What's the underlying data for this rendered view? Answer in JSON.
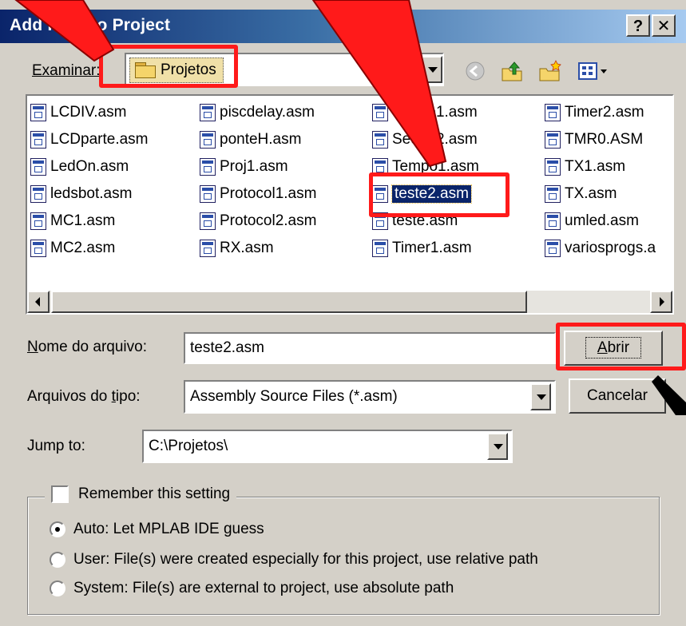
{
  "window": {
    "title": "Add Files to Project",
    "help_button": "?",
    "close_button": "✕"
  },
  "lookin": {
    "label": "Examinar:",
    "value": "Projetos"
  },
  "files": [
    [
      "LCDIV.asm",
      "piscdelay.asm",
      "Seque1.asm",
      "Timer2.asm"
    ],
    [
      "LCDparte.asm",
      "ponteH.asm",
      "Seque2.asm",
      "TMR0.ASM"
    ],
    [
      "LedOn.asm",
      "Proj1.asm",
      "Tempo1.asm",
      "TX1.asm"
    ],
    [
      "ledsbot.asm",
      "Protocol1.asm",
      "teste2.asm",
      "TX.asm"
    ],
    [
      "MC1.asm",
      "Protocol2.asm",
      "teste.asm",
      "umled.asm"
    ],
    [
      "MC2.asm",
      "RX.asm",
      "Timer1.asm",
      "variosprogs.a"
    ]
  ],
  "selected_file": "teste2.asm",
  "filename": {
    "label_u": "N",
    "label_rest": "ome do arquivo:",
    "value": "teste2.asm"
  },
  "filetype": {
    "label_pre": "Arquivos do ",
    "label_u": "t",
    "label_post": "ipo:",
    "value": "Assembly Source Files (*.asm)"
  },
  "jumpto": {
    "label": "Jump to:",
    "value": "C:\\Projetos\\"
  },
  "buttons": {
    "open_u": "A",
    "open_rest": "brir",
    "cancel": "Cancelar"
  },
  "remember": {
    "label": "Remember this setting",
    "checked": false
  },
  "path_options": [
    {
      "label": "Auto: Let MPLAB IDE guess",
      "checked": true
    },
    {
      "label": "User: File(s) were created especially for this project, use relative path",
      "checked": false
    },
    {
      "label": "System: File(s) are external to project, use absolute path",
      "checked": false
    }
  ],
  "colors": {
    "titlebar_start": "#0a246a",
    "titlebar_end": "#a6caf0",
    "annotation_red": "#ff1a1a",
    "selection": "#0a246a"
  }
}
